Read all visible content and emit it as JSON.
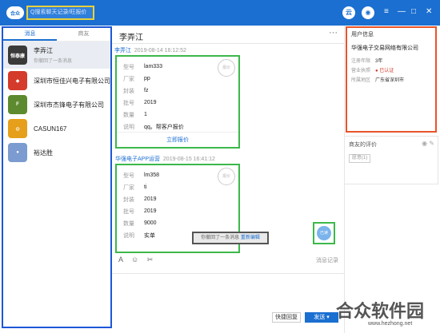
{
  "titlebar": {
    "logo_text": "合众",
    "search_placeholder": "Q搜索聊天记录/旺报价",
    "btn_cloud": "云",
    "btn_user": "◉",
    "win_menu": "≡",
    "win_min": "—",
    "win_max": "□",
    "win_close": "✕"
  },
  "left": {
    "tabs": [
      {
        "label": "消息"
      },
      {
        "label": "商友"
      }
    ],
    "contacts": [
      {
        "name": "李弄江",
        "sub": "你撤回了一条消息",
        "avatar": "恒泰康",
        "avatar_color": "#3a3a3a"
      },
      {
        "name": "深圳市恒佳兴电子有限公司",
        "sub": "",
        "avatar": "◆",
        "avatar_color": "#d43b2a"
      },
      {
        "name": "深圳市杰锋电子有限公司",
        "sub": "",
        "avatar": "F",
        "avatar_color": "#5d8a2e"
      },
      {
        "name": "CASUN167",
        "sub": "",
        "avatar": "◍",
        "avatar_color": "#e59f1a"
      },
      {
        "name": "裕达胜",
        "sub": "",
        "avatar": "●",
        "avatar_color": "#7c9bd0"
      }
    ]
  },
  "chat": {
    "title": "李弄江",
    "more": "···",
    "msg1": {
      "sender": "李弄江",
      "time": "2019-08-14 16:12:52"
    },
    "card1": {
      "stamp": "报价",
      "rows": [
        {
          "k": "型号",
          "v": "lam333"
        },
        {
          "k": "厂家",
          "v": "pp"
        },
        {
          "k": "封装",
          "v": "fz"
        },
        {
          "k": "批号",
          "v": "2019"
        },
        {
          "k": "数量",
          "v": "1"
        },
        {
          "k": "说明",
          "v": "qq。帮客户报价"
        }
      ],
      "button": "立即报价"
    },
    "msg2": {
      "sender": "华强电子APP运营",
      "time": "2019-08-15 16:41:12"
    },
    "card2": {
      "stamp": "报价",
      "rows": [
        {
          "k": "型号",
          "v": "lm358"
        },
        {
          "k": "厂家",
          "v": "ti"
        },
        {
          "k": "封装",
          "v": "2019"
        },
        {
          "k": "批号",
          "v": "2019"
        },
        {
          "k": "数量",
          "v": "9000"
        },
        {
          "k": "说明",
          "v": "实单"
        }
      ]
    },
    "recall_text": "你撤回了一条消息",
    "recall_edit": "重新编辑",
    "read_label": "已读",
    "toolbar_icons": "A ☺ ✂",
    "history": "消息记录",
    "quick_reply": "快捷回复",
    "send": "发送 ▾"
  },
  "right": {
    "title": "用户信息",
    "company": "华强电子交易网络有限公司",
    "info": [
      {
        "k": "注册年限",
        "v": "3年"
      },
      {
        "k": "营业执照",
        "v": "● 已认证"
      },
      {
        "k": "所属地区",
        "v": "广东省深圳市"
      }
    ],
    "review_title": "商友的评价",
    "review_icons": "◉ ✎",
    "review_chip": "愿意(1)"
  },
  "watermark": {
    "big": "合众软件园",
    "small": "www.hezhong.net"
  },
  "colors": {
    "brand": "#1b6fd0",
    "accent_orange": "#e8542a",
    "accent_green": "#3cb84a"
  }
}
